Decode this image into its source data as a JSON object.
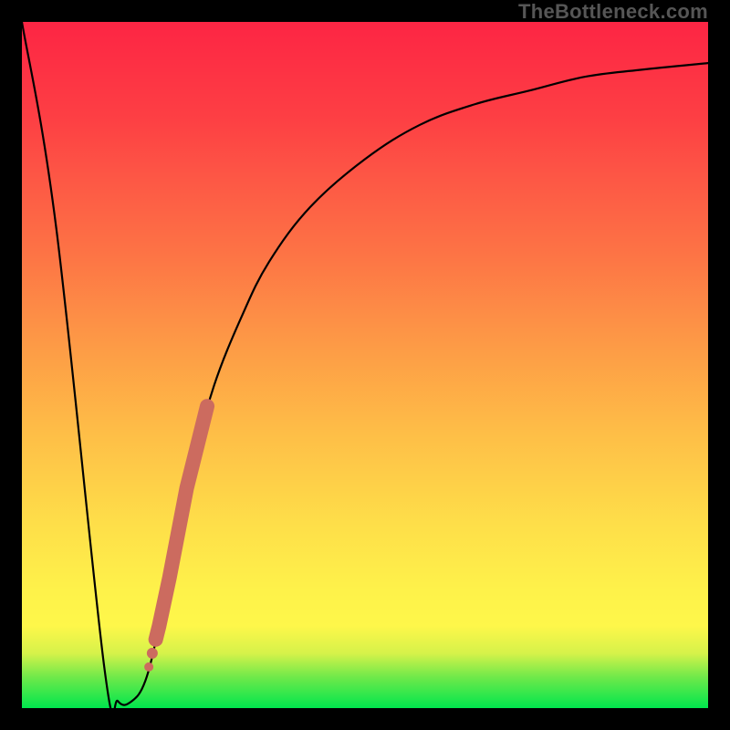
{
  "watermark": "TheBottleneck.com",
  "chart_data": {
    "type": "line",
    "title": "",
    "xlabel": "",
    "ylabel": "",
    "xlim": [
      0,
      100
    ],
    "ylim": [
      0,
      100
    ],
    "series": [
      {
        "name": "bottleneck-curve",
        "x": [
          0,
          5,
          12,
          14,
          16,
          18,
          20,
          22,
          25,
          28,
          32,
          36,
          42,
          50,
          58,
          66,
          74,
          82,
          90,
          100
        ],
        "y": [
          100,
          70,
          6,
          1,
          1,
          4,
          12,
          22,
          36,
          47,
          57,
          65,
          73,
          80,
          85,
          88,
          90,
          92,
          93,
          94
        ]
      }
    ],
    "highlight_segment": {
      "name": "highlighted-range",
      "color": "#cc6b5f",
      "points": [
        {
          "x": 18.5,
          "y": 6
        },
        {
          "x": 19.0,
          "y": 8
        },
        {
          "x": 19.5,
          "y": 10
        },
        {
          "x": 20.0,
          "y": 12
        },
        {
          "x": 21.5,
          "y": 19
        },
        {
          "x": 24.0,
          "y": 32
        },
        {
          "x": 27.0,
          "y": 44
        }
      ]
    },
    "background_gradient": {
      "top": "#fd2544",
      "upper_mid": "#fd7445",
      "mid": "#fef24a",
      "lower_mid": "#6fe94a",
      "bottom": "#00e64d"
    }
  }
}
